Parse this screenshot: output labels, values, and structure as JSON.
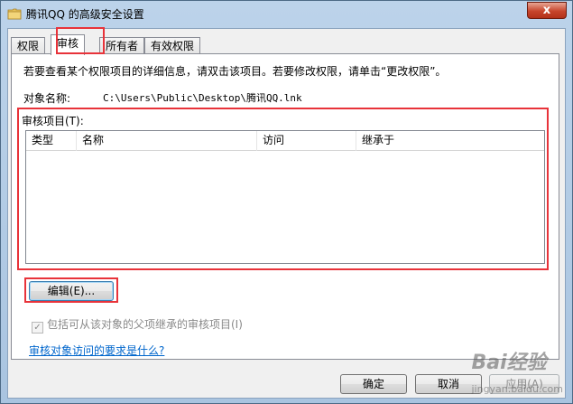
{
  "window": {
    "title": "腾讯QQ 的高级安全设置",
    "close_label": "x"
  },
  "tabs": [
    {
      "label": "权限",
      "active": false
    },
    {
      "label": "审核",
      "active": true
    },
    {
      "label": "所有者",
      "active": false
    },
    {
      "label": "有效权限",
      "active": false
    }
  ],
  "panel": {
    "description": "若要查看某个权限项目的详细信息，请双击该项目。若要修改权限，请单击“更改权限”。",
    "object_name_label": "对象名称:",
    "object_name_value": "C:\\Users\\Public\\Desktop\\腾讯QQ.lnk",
    "audit_items_label": "审核项目(T):",
    "columns": [
      "类型",
      "名称",
      "访问",
      "继承于"
    ],
    "edit_button": "编辑(E)...",
    "inherit_checkbox": {
      "label": "包括可从该对象的父项继承的审核项目(I)",
      "checked": true,
      "disabled": true
    },
    "help_link": "审核对象访问的要求是什么?"
  },
  "footer": {
    "ok": "确定",
    "cancel": "取消",
    "apply": "应用(A)"
  },
  "watermark": {
    "main": "Bai经验",
    "sub": "jingyan.baidu.com"
  },
  "colors": {
    "highlight_red": "#e8333a",
    "link_blue": "#0066cc"
  }
}
